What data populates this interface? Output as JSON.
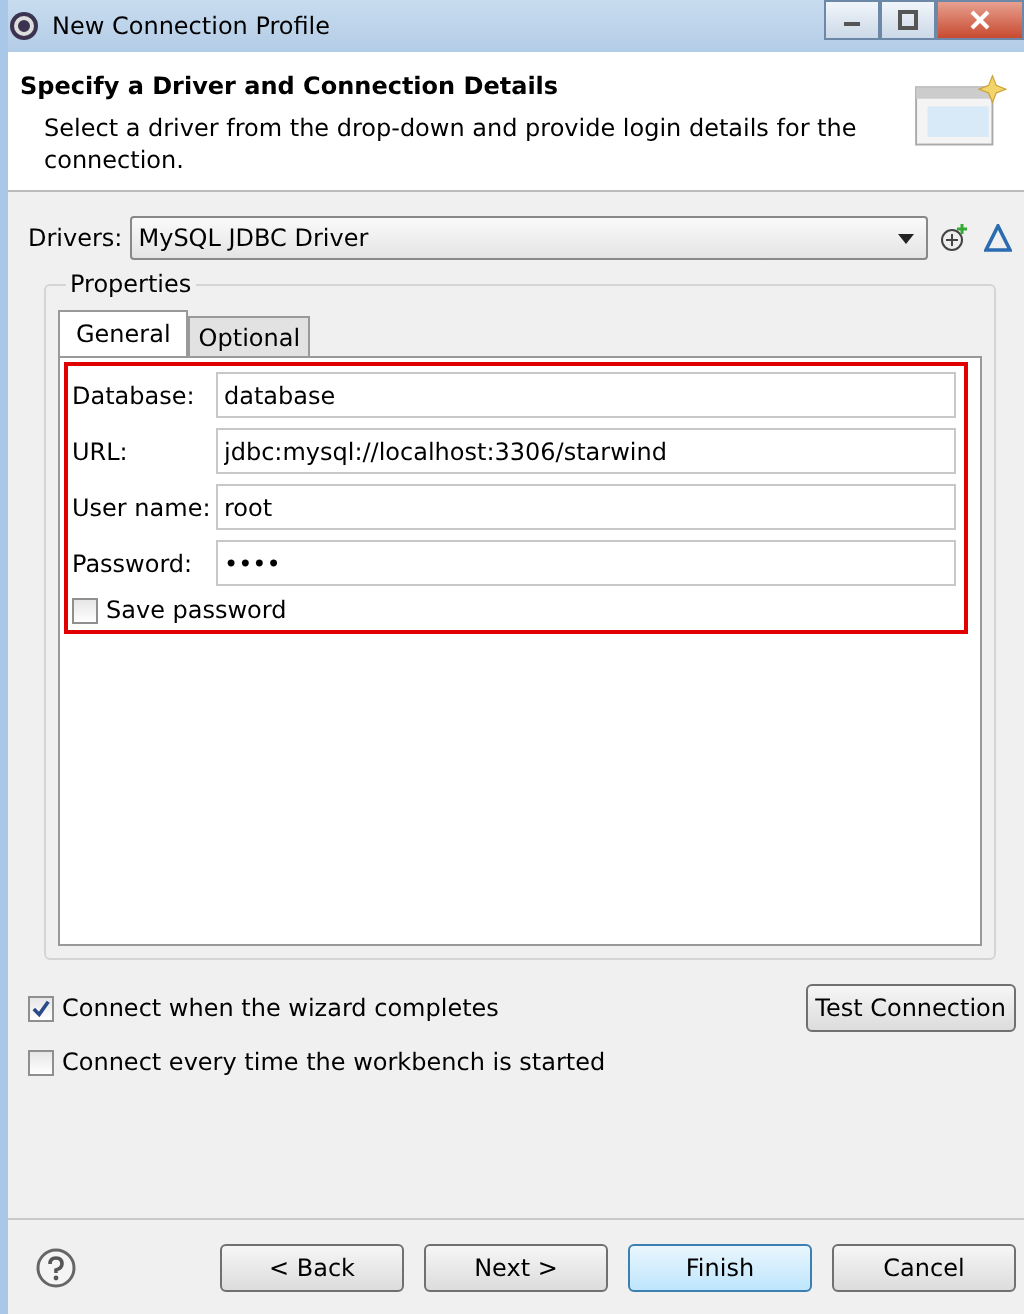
{
  "window": {
    "title": "New Connection Profile"
  },
  "header": {
    "title": "Specify a Driver and Connection Details",
    "description": "Select a driver from the drop-down and provide login details for the connection."
  },
  "drivers": {
    "label": "Drivers:",
    "value": "MySQL JDBC Driver"
  },
  "properties": {
    "title": "Properties",
    "tabs": [
      {
        "label": "General",
        "selected": true
      },
      {
        "label": "Optional",
        "selected": false
      }
    ],
    "fields": [
      {
        "label": "Database:",
        "value": "database"
      },
      {
        "label": "URL:",
        "value": "jdbc:mysql://localhost:3306/starwind"
      },
      {
        "label": "User name:",
        "value": "root"
      },
      {
        "label": "Password:",
        "value": "••••"
      }
    ],
    "save_password": {
      "label": "Save password",
      "checked": false
    }
  },
  "options": [
    {
      "label": "Connect when the wizard completes",
      "checked": true
    },
    {
      "label": "Connect every time the workbench is started",
      "checked": false
    }
  ],
  "test_button": "Test Connection",
  "buttons": [
    {
      "label": "< Back",
      "default": false
    },
    {
      "label": "Next >",
      "default": false
    },
    {
      "label": "Finish",
      "default": true
    },
    {
      "label": "Cancel",
      "default": false
    }
  ]
}
